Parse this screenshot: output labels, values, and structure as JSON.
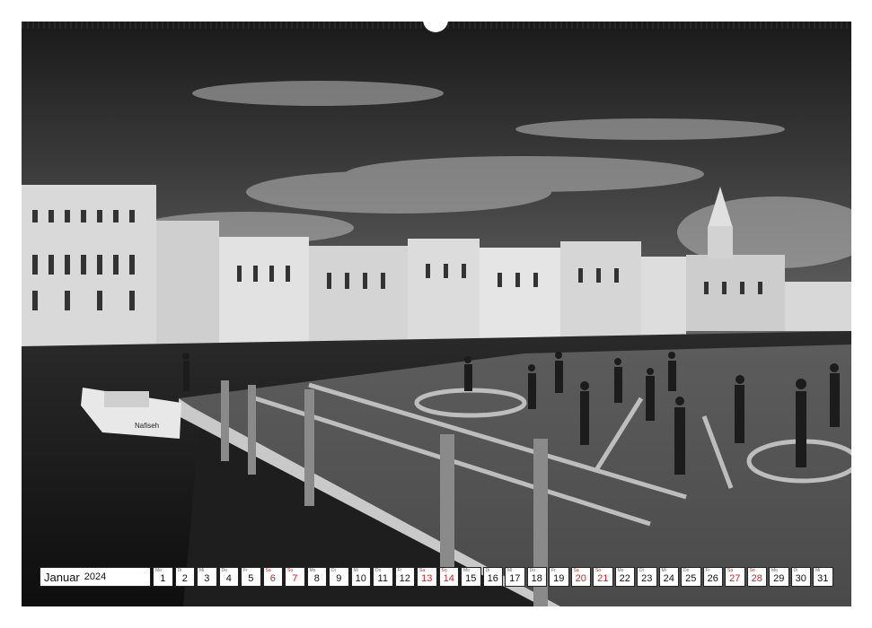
{
  "calendar": {
    "month": "Januar",
    "year": "2024",
    "days": [
      {
        "dow": "Mo",
        "num": "1",
        "sunday": false
      },
      {
        "dow": "Di",
        "num": "2",
        "sunday": false
      },
      {
        "dow": "Mi",
        "num": "3",
        "sunday": false
      },
      {
        "dow": "Do",
        "num": "4",
        "sunday": false
      },
      {
        "dow": "Fr",
        "num": "5",
        "sunday": false
      },
      {
        "dow": "Sa",
        "num": "6",
        "sunday": true
      },
      {
        "dow": "So",
        "num": "7",
        "sunday": true
      },
      {
        "dow": "Mo",
        "num": "8",
        "sunday": false
      },
      {
        "dow": "Di",
        "num": "9",
        "sunday": false
      },
      {
        "dow": "Mi",
        "num": "10",
        "sunday": false
      },
      {
        "dow": "Do",
        "num": "11",
        "sunday": false
      },
      {
        "dow": "Fr",
        "num": "12",
        "sunday": false
      },
      {
        "dow": "Sa",
        "num": "13",
        "sunday": true
      },
      {
        "dow": "So",
        "num": "14",
        "sunday": true
      },
      {
        "dow": "Mo",
        "num": "15",
        "sunday": false
      },
      {
        "dow": "Di",
        "num": "16",
        "sunday": false
      },
      {
        "dow": "Mi",
        "num": "17",
        "sunday": false
      },
      {
        "dow": "Do",
        "num": "18",
        "sunday": false
      },
      {
        "dow": "Fr",
        "num": "19",
        "sunday": false
      },
      {
        "dow": "Sa",
        "num": "20",
        "sunday": true
      },
      {
        "dow": "So",
        "num": "21",
        "sunday": true
      },
      {
        "dow": "Mo",
        "num": "22",
        "sunday": false
      },
      {
        "dow": "Di",
        "num": "23",
        "sunday": false
      },
      {
        "dow": "Mi",
        "num": "24",
        "sunday": false
      },
      {
        "dow": "Do",
        "num": "25",
        "sunday": false
      },
      {
        "dow": "Fr",
        "num": "26",
        "sunday": false
      },
      {
        "dow": "Sa",
        "num": "27",
        "sunday": true
      },
      {
        "dow": "So",
        "num": "28",
        "sunday": true
      },
      {
        "dow": "Mo",
        "num": "29",
        "sunday": false
      },
      {
        "dow": "Di",
        "num": "30",
        "sunday": false
      },
      {
        "dow": "Mi",
        "num": "31",
        "sunday": false
      }
    ]
  },
  "photo": {
    "boat_name": "Nafiseh"
  },
  "colors": {
    "sunday_red": "#c0282d",
    "grid_border": "#222222"
  }
}
